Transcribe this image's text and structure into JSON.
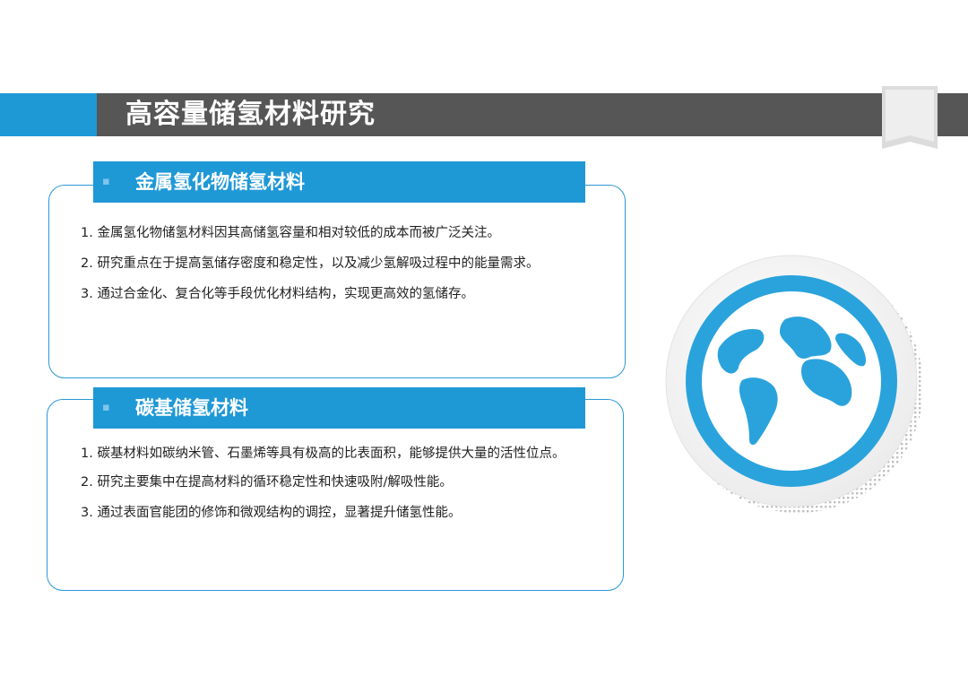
{
  "header": {
    "title": "高容量储氢材料研究"
  },
  "sections": [
    {
      "bullet": "▪",
      "title": "金属氢化物储氢材料",
      "items": [
        "1. 金属氢化物储氢材料因其高储氢容量和相对较低的成本而被广泛关注。",
        "2. 研究重点在于提高氢储存密度和稳定性，以及减少氢解吸过程中的能量需求。",
        "3. 通过合金化、复合化等手段优化材料结构，实现更高效的氢储存。"
      ]
    },
    {
      "bullet": "▪",
      "title": "碳基储氢材料",
      "items": [
        "1. 碳基材料如碳纳米管、石墨烯等具有极高的比表面积，能够提供大量的活性位点。",
        "2. 研究主要集中在提高材料的循环稳定性和快速吸附/解吸性能。",
        "3. 通过表面官能团的修饰和微观结构的调控，显著提升储氢性能。"
      ]
    }
  ],
  "colors": {
    "accent": "#1f98d6",
    "title_bar": "#565656",
    "globe": "#2aa3dc"
  },
  "icons": {
    "globe": "globe-icon",
    "bookmark": "bookmark-icon"
  }
}
